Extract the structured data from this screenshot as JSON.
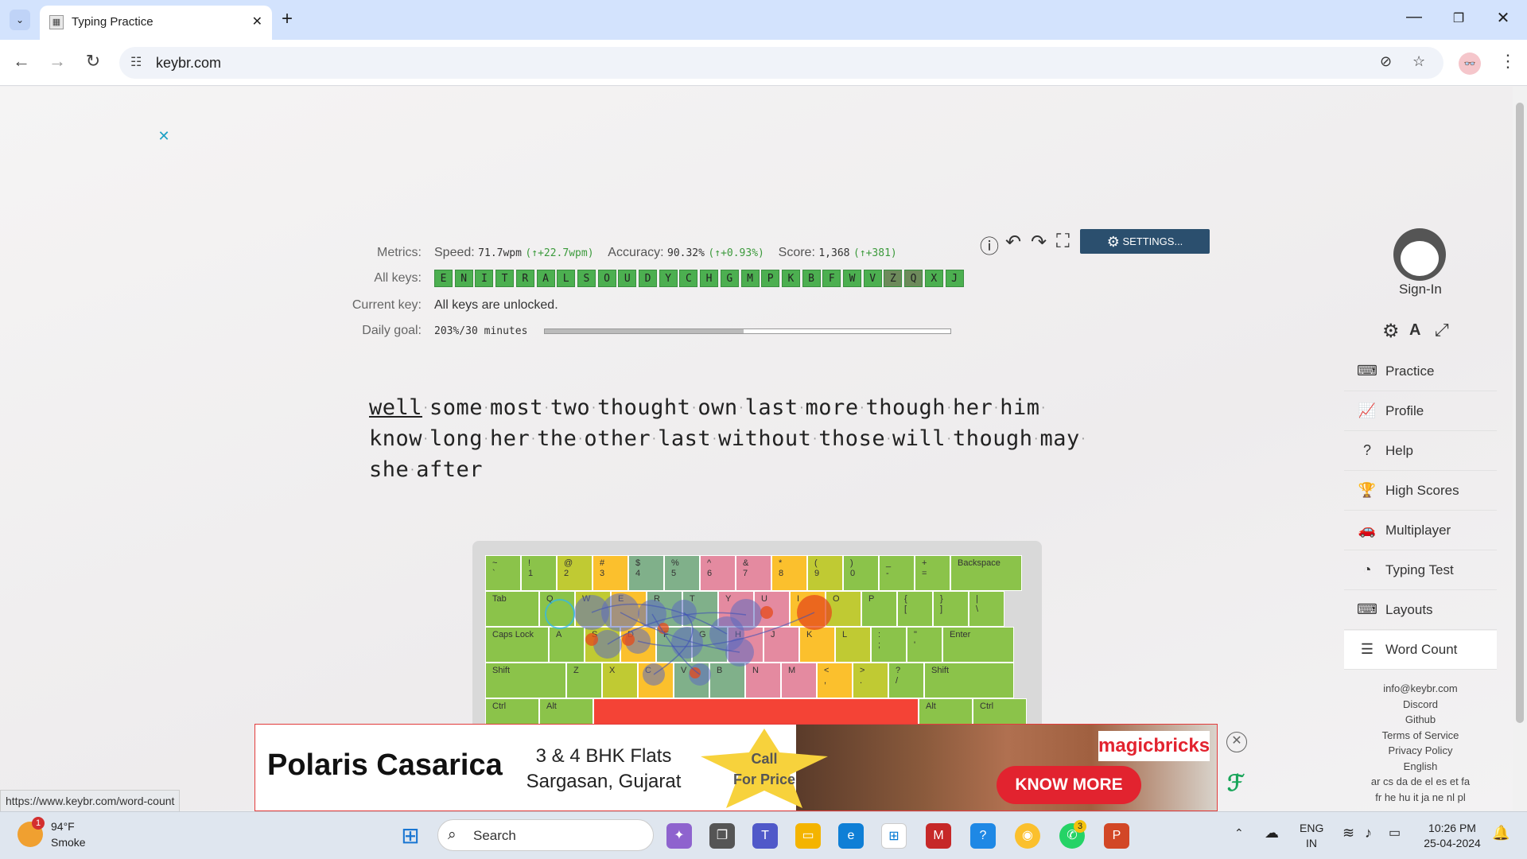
{
  "browser": {
    "tab_title": "Typing Practice",
    "url": "keybr.com",
    "status_url": "https://www.keybr.com/word-count"
  },
  "metrics": {
    "label": "Metrics:",
    "speed_label": "Speed:",
    "speed_value": "71.7wpm",
    "speed_delta": "(↑+22.7wpm)",
    "accuracy_label": "Accuracy:",
    "accuracy_value": "90.32%",
    "accuracy_delta": "(↑+0.93%)",
    "score_label": "Score:",
    "score_value": "1,368",
    "score_delta": "(↑+381)",
    "all_keys_label": "All keys:",
    "keys": [
      "E",
      "N",
      "I",
      "T",
      "R",
      "A",
      "L",
      "S",
      "O",
      "U",
      "D",
      "Y",
      "C",
      "H",
      "G",
      "M",
      "P",
      "K",
      "B",
      "F",
      "W",
      "V",
      "Z",
      "Q",
      "X",
      "J"
    ],
    "current_key_label": "Current key:",
    "current_key_value": "All keys are unlocked.",
    "daily_goal_label": "Daily goal:",
    "daily_goal_value": "203%/30 minutes",
    "daily_goal_fill": 0.49
  },
  "settings_label": "SETTINGS...",
  "typing": {
    "line1": [
      "well",
      "some",
      "most",
      "two",
      "thought",
      "own",
      "last",
      "more",
      "though",
      "her",
      "him"
    ],
    "line2": [
      "know",
      "long",
      "her",
      "the",
      "other",
      "last",
      "without",
      "those",
      "will",
      "though",
      "may"
    ],
    "line3": [
      "she",
      "after"
    ]
  },
  "keyboard": {
    "row1": [
      "~\n`",
      "!\n1",
      "@\n2",
      "#\n3",
      "$\n4",
      "%\n5",
      "^\n6",
      "&\n7",
      "*\n8",
      "(\n9",
      ")\n0",
      "_\n-",
      "+\n="
    ],
    "backspace": "Backspace",
    "tab": "Tab",
    "row2": [
      "Q",
      "W",
      "E",
      "R",
      "T",
      "Y",
      "U",
      "I",
      "O",
      "P",
      "{\n[",
      "}\n]",
      "|\n\\"
    ],
    "caps": "Caps Lock",
    "row3": [
      "A",
      "S",
      "D",
      "F",
      "G",
      "H",
      "J",
      "K",
      "L",
      ":\n;",
      "\"\n'"
    ],
    "enter": "Enter",
    "shift_left": "Shift",
    "row4": [
      "Z",
      "X",
      "C",
      "V",
      "B",
      "N",
      "M",
      "<\n,",
      ">\n.",
      "?\n/"
    ],
    "shift_right": "Shift",
    "ctrl": "Ctrl",
    "alt": "Alt"
  },
  "sidebar": {
    "sign_in": "Sign-In",
    "items": [
      {
        "label": "Practice",
        "icon": "keyboard-icon"
      },
      {
        "label": "Profile",
        "icon": "chart-icon"
      },
      {
        "label": "Help",
        "icon": "question-icon"
      },
      {
        "label": "High Scores",
        "icon": "trophy-icon"
      },
      {
        "label": "Multiplayer",
        "icon": "car-icon"
      },
      {
        "label": "Typing Test",
        "icon": "speedometer-icon"
      },
      {
        "label": "Layouts",
        "icon": "keyboard-icon"
      },
      {
        "label": "Word Count",
        "icon": "document-icon"
      }
    ],
    "footer": [
      "info@keybr.com",
      "Discord",
      "Github",
      "Terms of Service",
      "Privacy Policy",
      "English",
      "ar cs da de el es et fa",
      "fr he hu it ja ne nl pl"
    ]
  },
  "ad": {
    "title": "Polaris Casarica",
    "line1": "3 & 4 BHK Flats",
    "line2": "Sargasan, Gujarat",
    "call": "Call",
    "for_price": "For Price",
    "brand": "magicbricks",
    "cta": "KNOW MORE"
  },
  "taskbar": {
    "weather_temp": "94°F",
    "weather_desc": "Smoke",
    "weather_badge": "1",
    "search": "Search",
    "lang1": "ENG",
    "lang2": "IN",
    "time": "10:26 PM",
    "date": "25-04-2024",
    "whatsapp_badge": "3"
  }
}
